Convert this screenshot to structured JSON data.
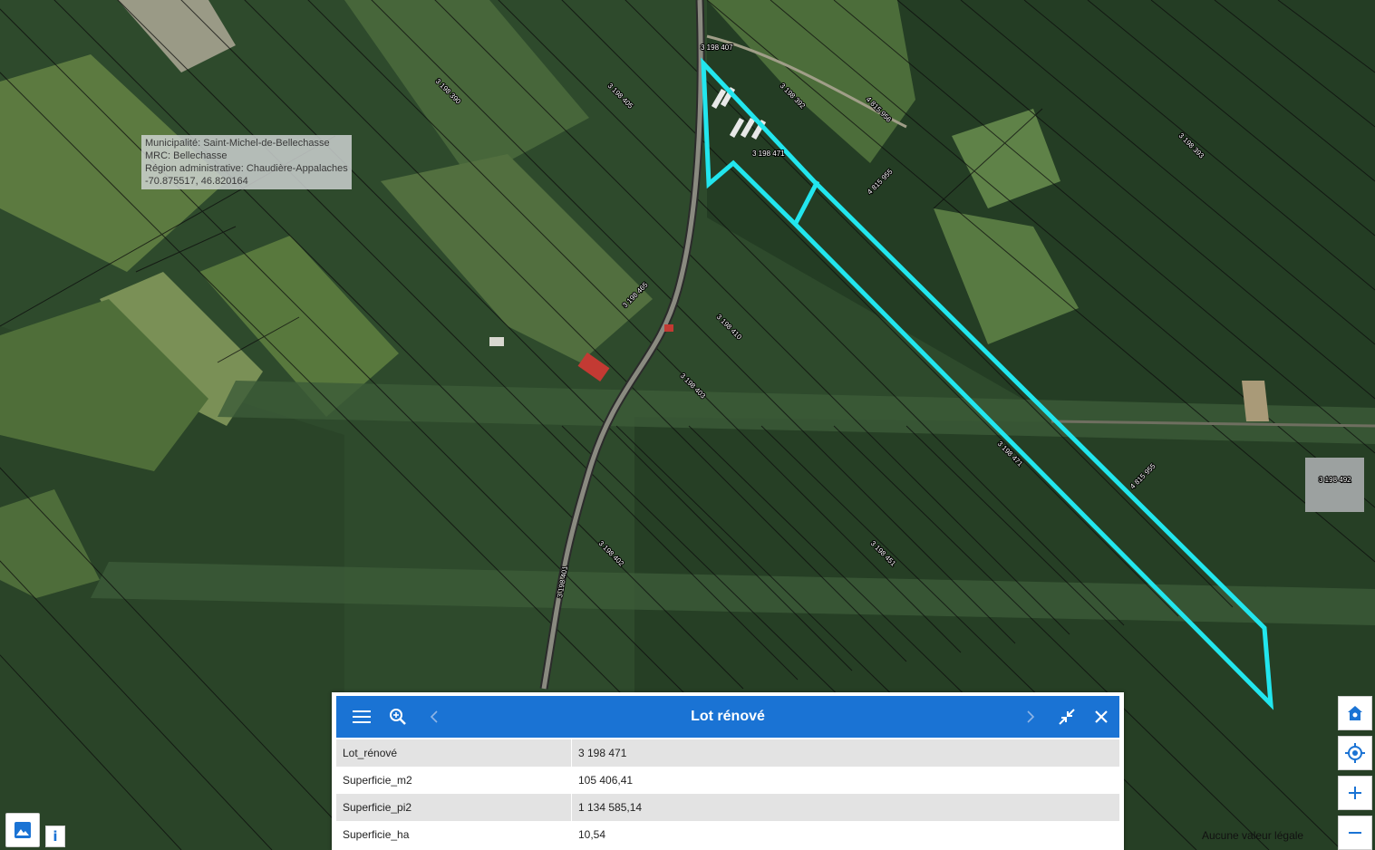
{
  "info_box": {
    "municipalite": "Municipalité: Saint-Michel-de-Bellechasse",
    "mrc": "MRC: Bellechasse",
    "region": "Région administrative: Chaudière-Appalaches",
    "coords": "-70.875517, 46.820164"
  },
  "parcel_labels": [
    "3 198 407",
    "3 198 471",
    "3 198 405",
    "4 815 956",
    "4 815 955",
    "3 198 492",
    "3 198 471",
    "3 198 410",
    "3 198 403",
    "3 198 451",
    "4 815 955",
    "3 198 465",
    "3 198 402",
    "3 198 401",
    "3 198 390",
    "3 198 392",
    "3 198 393"
  ],
  "panel": {
    "title": "Lot rénové",
    "rows": [
      {
        "key": "Lot_rénové",
        "value": "3 198 471"
      },
      {
        "key": "Superficie_m2",
        "value": "105 406,41"
      },
      {
        "key": "Superficie_pi2",
        "value": "1 134 585,14"
      },
      {
        "key": "Superficie_ha",
        "value": "10,54"
      }
    ]
  },
  "status": {
    "legal": "Aucune valeur légale"
  },
  "buttons": {
    "info": "i"
  },
  "colors": {
    "highlight": "#22e6ee",
    "header": "#1a73d4",
    "forest": "#2f4a2c"
  },
  "icons": [
    "menu-icon",
    "zoom-to-icon",
    "chevron-left-icon",
    "chevron-right-icon",
    "collapse-icon",
    "close-icon",
    "home-icon",
    "locate-icon",
    "plus-icon",
    "minus-icon",
    "basemap-icon",
    "info-icon"
  ]
}
